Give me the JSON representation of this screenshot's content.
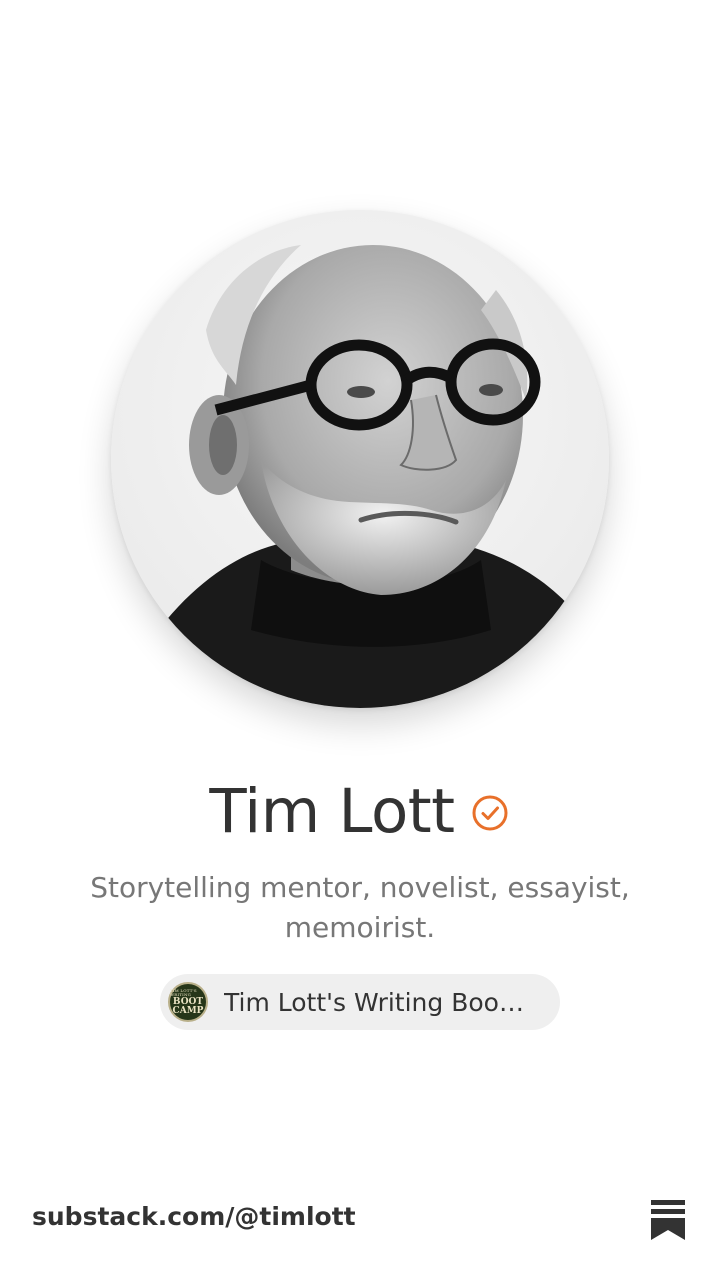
{
  "profile": {
    "name": "Tim Lott",
    "verified_icon": "verified-check-icon",
    "bio": "Storytelling mentor, novelist, essayist, memoirist.",
    "avatar_icon": "profile-photo"
  },
  "publication": {
    "name": "Tim Lott's Writing Boot ...",
    "logo_icon": "publication-logo",
    "logo_lines": [
      "TIM LOTT'S WRITING",
      "BOOT",
      "CAMP"
    ]
  },
  "footer": {
    "url": "substack.com/@timlott",
    "brand_icon": "substack-logo-icon"
  },
  "colors": {
    "accent": "#e8702a",
    "text_primary": "#333333",
    "text_secondary": "#777777",
    "pill_background": "#efefef"
  }
}
